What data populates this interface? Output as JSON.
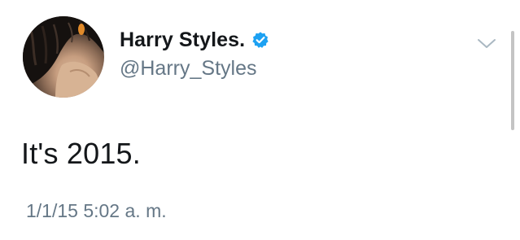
{
  "user": {
    "display_name": "Harry Styles.",
    "handle": "@Harry_Styles",
    "verified_icon": "verified-badge-icon",
    "avatar": "profile-avatar"
  },
  "tweet": {
    "text": "It's 2015.",
    "timestamp": "1/1/15 5:02 a. m."
  },
  "menu": {
    "icon": "chevron-down-icon"
  },
  "colors": {
    "name": "#14171a",
    "secondary": "#657786",
    "verified": "#1da1f2"
  }
}
